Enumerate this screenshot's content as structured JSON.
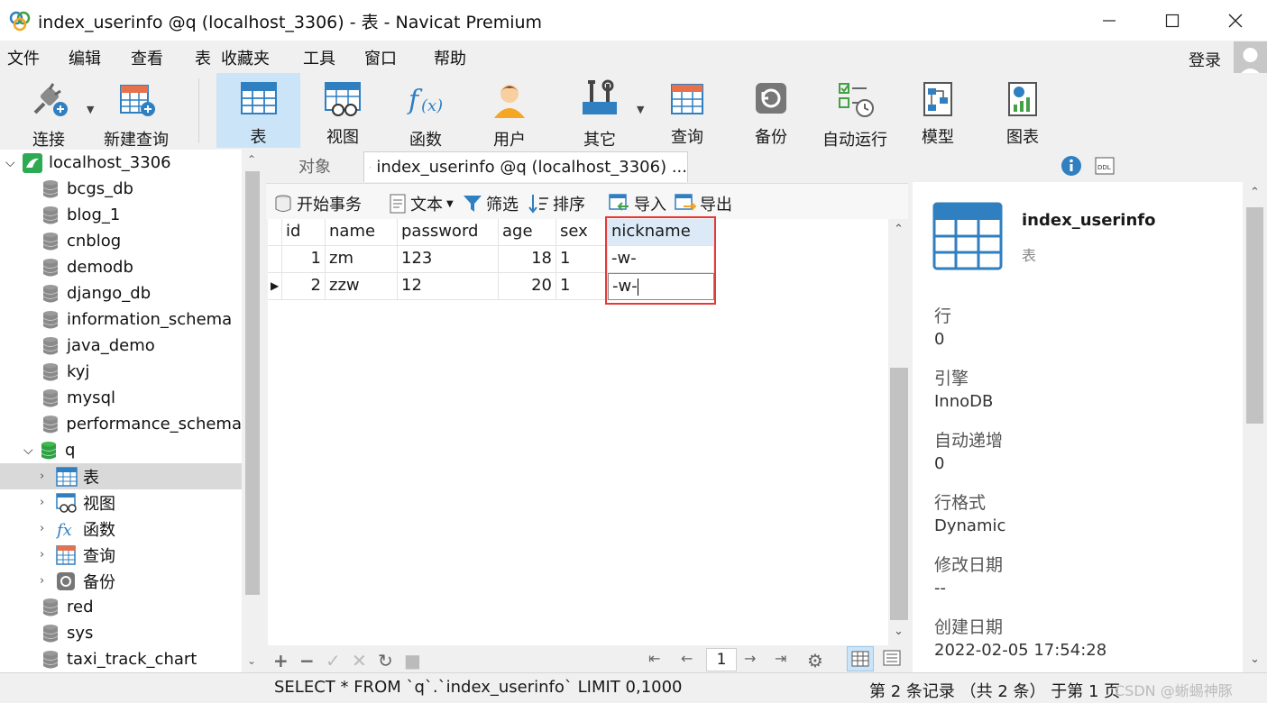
{
  "window": {
    "title": "index_userinfo @q (localhost_3306) - 表 - Navicat Premium"
  },
  "menu": {
    "items": [
      "文件",
      "编辑",
      "查看",
      "表",
      "收藏夹",
      "工具",
      "窗口",
      "帮助"
    ],
    "login": "登录"
  },
  "toolbar": {
    "buttons": [
      "连接",
      "新建查询",
      "表",
      "视图",
      "函数",
      "用户",
      "其它",
      "查询",
      "备份",
      "自动运行",
      "模型",
      "图表"
    ]
  },
  "tree": {
    "connection": "localhost_3306",
    "databases": [
      "bcgs_db",
      "blog_1",
      "cnblog",
      "demodb",
      "django_db",
      "information_schema",
      "java_demo",
      "kyj",
      "mysql",
      "performance_schema",
      "q"
    ],
    "q_children": [
      "表",
      "视图",
      "函数",
      "查询",
      "备份"
    ],
    "after": [
      "red",
      "sys",
      "taxi_track_chart"
    ]
  },
  "tabs": {
    "objects": "对象",
    "active": "index_userinfo @q (localhost_3306) ..."
  },
  "subtoolbar": {
    "begin_tx": "开始事务",
    "text": "文本",
    "filter": "筛选",
    "sort": "排序",
    "import": "导入",
    "export": "导出"
  },
  "grid": {
    "columns": [
      "id",
      "name",
      "password",
      "age",
      "sex",
      "nickname"
    ],
    "rows": [
      [
        "1",
        "zm",
        "123",
        "18",
        "1",
        "-w-"
      ],
      [
        "2",
        "zzw",
        "12",
        "20",
        "1",
        "-w-"
      ]
    ]
  },
  "pager": {
    "page": "1"
  },
  "info": {
    "name": "index_userinfo",
    "type": "表",
    "fields": [
      {
        "label": "行",
        "value": "0"
      },
      {
        "label": "引擎",
        "value": "InnoDB"
      },
      {
        "label": "自动递增",
        "value": "0"
      },
      {
        "label": "行格式",
        "value": "Dynamic"
      },
      {
        "label": "修改日期",
        "value": "--"
      },
      {
        "label": "创建日期",
        "value": "2022-02-05 17:54:28"
      }
    ]
  },
  "status": {
    "sql": "SELECT * FROM `q`.`index_userinfo` LIMIT 0,1000",
    "records": "第 2 条记录 （共 2 条） 于第 1 页",
    "watermark": "CSDN @蜥蜴神豚"
  },
  "colors": {
    "accent": "#2f7fc1",
    "selection": "#cce4f7",
    "highlight": "#e53935"
  }
}
